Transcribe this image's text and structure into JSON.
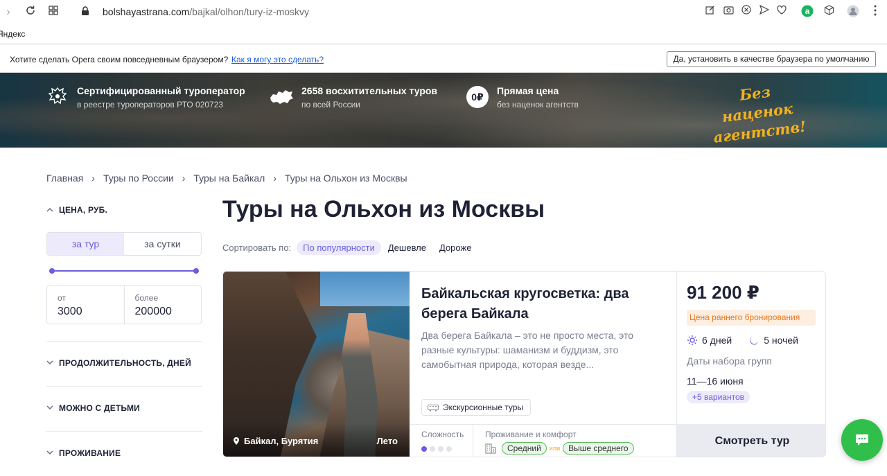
{
  "browser": {
    "url_domain": "bolshayastrana.com",
    "url_path": "/bajkal/olhon/tury-iz-moskvy",
    "bookmark": "Яндекс"
  },
  "opera": {
    "question": "Хотите сделать Opera своим повседневным браузером?",
    "link": "Как я могу это сделать?",
    "button": "Да, установить в качестве браузера по умолчанию"
  },
  "hero": {
    "item1": {
      "title": "Сертифицированный туроператор",
      "sub": "в реестре туроператоров РТО 020723"
    },
    "item2": {
      "title": "2658 восхитительных туров",
      "sub": "по всей России"
    },
    "item3": {
      "title": "Прямая цена",
      "sub": "без наценок агентств",
      "badge": "0₽"
    },
    "slogan": "Без наценок агентств!"
  },
  "breadcrumbs": [
    "Главная",
    "Туры по России",
    "Туры на Байкал",
    "Туры на Ольхон из Москвы"
  ],
  "page_title": "Туры на Ольхон из Москвы",
  "sort": {
    "label": "Сортировать по:",
    "options": [
      "По популярности",
      "Дешевле",
      "Дороже"
    ]
  },
  "filters": {
    "price_title": "ЦЕНА, РУБ.",
    "per_tour": "за тур",
    "per_day": "за сутки",
    "from_label": "от",
    "from_value": "3000",
    "to_label": "более",
    "to_value": "200000",
    "duration": "ПРОДОЛЖИТЕЛЬНОСТЬ, ДНЕЙ",
    "kids": "МОЖНО С ДЕТЬМИ",
    "accommodation": "ПРОЖИВАНИЕ"
  },
  "tour": {
    "title": "Байкальская кругосветка: два берега Байкала",
    "description": "Два берега Байкала – это не просто места, это разные культуры: шаманизм и буддизм, это самобытная природа, которая везде...",
    "location": "Байкал, Бурятия",
    "season": "Лето",
    "tag": "Экскурсионные туры",
    "difficulty_label": "Сложность",
    "difficulty_level": 1,
    "difficulty_max": 4,
    "comfort_label": "Проживание и комфорт",
    "comfort_a": "Средний",
    "comfort_or": "или",
    "comfort_b": "Выше среднего",
    "price": "91 200 ₽",
    "early_booking": "Цена раннего бронирования",
    "days": "6 дней",
    "nights": "5 ночей",
    "dates_label": "Даты набора групп",
    "dates": "11—16 июня",
    "variants": "+5 вариантов",
    "cta": "Смотреть тур"
  },
  "colors": {
    "accent": "#6a5de0",
    "chat": "#2fbf4a",
    "orange": "#e6781f"
  }
}
